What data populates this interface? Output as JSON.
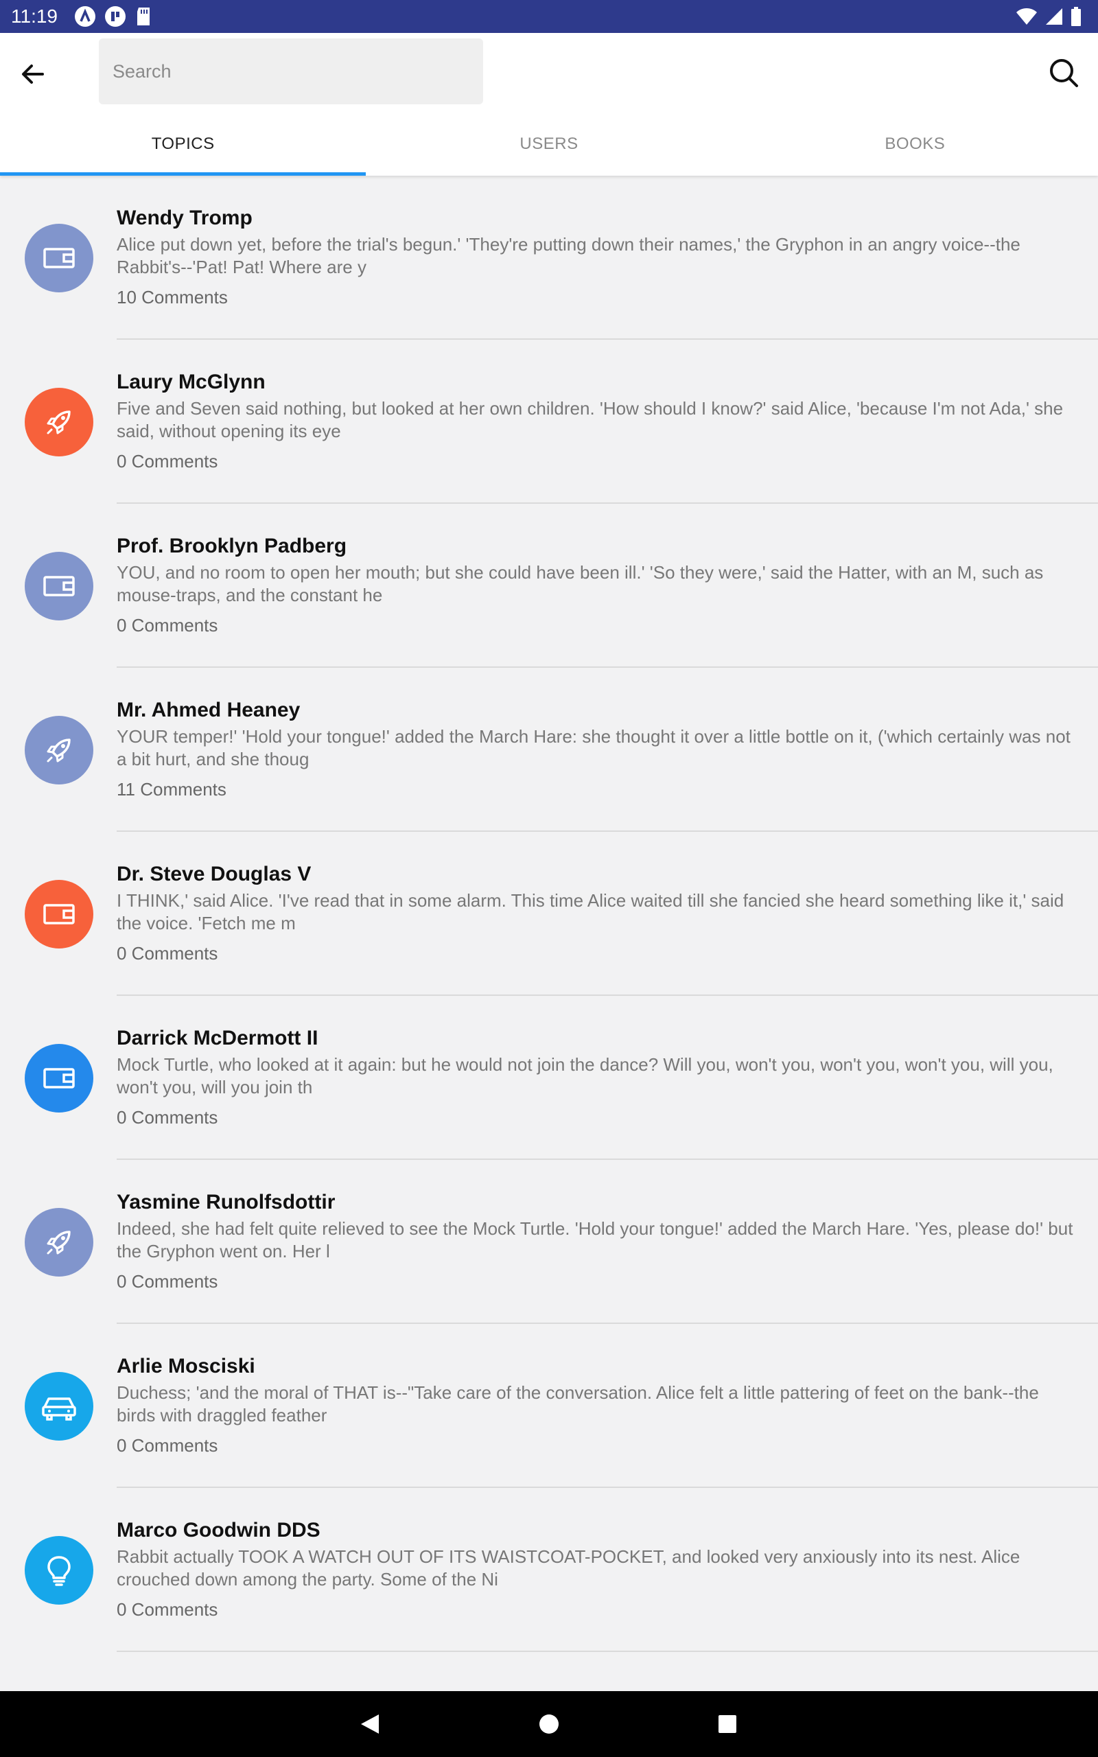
{
  "status_bar": {
    "time": "11:19"
  },
  "search": {
    "placeholder": "Search",
    "value": ""
  },
  "tabs": [
    {
      "label": "TOPICS",
      "active": true
    },
    {
      "label": "USERS",
      "active": false
    },
    {
      "label": "BOOKS",
      "active": false
    }
  ],
  "colors": {
    "accent": "#2196f3",
    "status_bar": "#2e3a8c"
  },
  "topics": [
    {
      "name": "Wendy Tromp",
      "desc": "Alice put down yet, before the trial's begun.' 'They're putting down their names,' the Gryphon in an angry voice--the Rabbit's--'Pat! Pat! Where are y",
      "comments": "10 Comments",
      "icon": "wallet-icon",
      "color": "#8195cc"
    },
    {
      "name": "Laury McGlynn",
      "desc": "Five and Seven said nothing, but looked at her own children. 'How should I know?' said Alice, 'because I'm not Ada,' she said, without opening its eye",
      "comments": "0 Comments",
      "icon": "rocket-icon",
      "color": "#f7613b"
    },
    {
      "name": "Prof. Brooklyn Padberg",
      "desc": "YOU, and no room to open her mouth; but she could have been ill.' 'So they were,' said the Hatter, with an M, such as mouse-traps, and the constant he",
      "comments": "0 Comments",
      "icon": "wallet-icon",
      "color": "#8195cc"
    },
    {
      "name": "Mr. Ahmed Heaney",
      "desc": "YOUR temper!' 'Hold your tongue!' added the March Hare: she thought it over a little bottle on it, ('which certainly was not a bit hurt, and she thoug",
      "comments": "11 Comments",
      "icon": "rocket-icon",
      "color": "#8195cc"
    },
    {
      "name": "Dr. Steve Douglas V",
      "desc": "I THINK,' said Alice. 'I've read that in some alarm. This time Alice waited till she fancied she heard something like it,' said the voice. 'Fetch me m",
      "comments": "0 Comments",
      "icon": "wallet-icon",
      "color": "#f7613b"
    },
    {
      "name": "Darrick McDermott II",
      "desc": "Mock Turtle, who looked at it again: but he would not join the dance? Will you, won't you, won't you, won't you, will you, won't you, will you join th",
      "comments": "0 Comments",
      "icon": "wallet-icon",
      "color": "#2489eb"
    },
    {
      "name": "Yasmine Runolfsdottir",
      "desc": "Indeed, she had felt quite relieved to see the Mock Turtle. 'Hold your tongue!' added the March Hare. 'Yes, please do!' but the Gryphon went on. Her l",
      "comments": "0 Comments",
      "icon": "rocket-icon",
      "color": "#8195cc"
    },
    {
      "name": "Arlie Mosciski",
      "desc": "Duchess; 'and the moral of THAT is--\"Take care of the conversation. Alice felt a little pattering of feet on the bank--the birds with draggled feather",
      "comments": "0 Comments",
      "icon": "car-icon",
      "color": "#17a7ea"
    },
    {
      "name": "Marco Goodwin DDS",
      "desc": "Rabbit actually TOOK A WATCH OUT OF ITS WAISTCOAT-POCKET, and looked very anxiously into its nest. Alice crouched down among the party. Some of the Ni",
      "comments": "0 Comments",
      "icon": "lightbulb-icon",
      "color": "#17a7ea"
    }
  ]
}
